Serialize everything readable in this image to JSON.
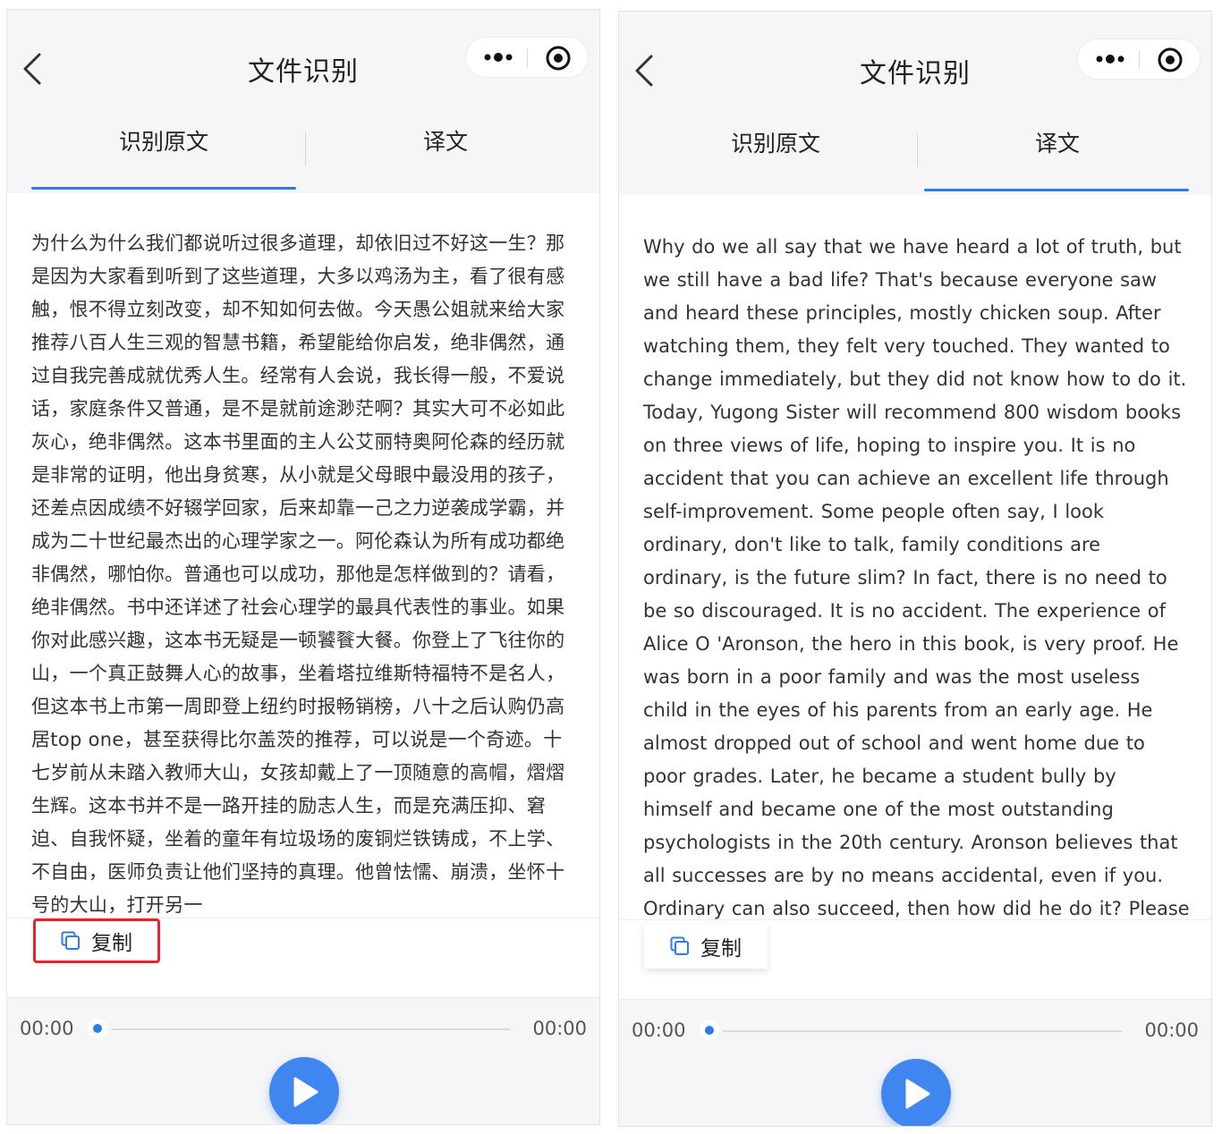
{
  "left_screen": {
    "title": "文件识别",
    "tabs": [
      "识别原文",
      "译文"
    ],
    "active_tab": "识别原文",
    "text": "为什么为什么我们都说听过很多道理，却依旧过不好这一生？那是因为大家看到听到了这些道理，大多以鸡汤为主，看了很有感触，恨不得立刻改变，却不知如何去做。今天愚公姐就来给大家推荐八百人生三观的智慧书籍，希望能给你启发，绝非偶然，通过自我完善成就优秀人生。经常有人会说，我长得一般，不爱说话，家庭条件又普通，是不是就前途渺茫啊？其实大可不必如此灰心，绝非偶然。这本书里面的主人公艾丽特奥阿伦森的经历就是非常的证明，他出身贫寒，从小就是父母眼中最没用的孩子，还差点因成绩不好辍学回家，后来却靠一己之力逆袭成学霸，并成为二十世纪最杰出的心理学家之一。阿伦森认为所有成功都绝非偶然，哪怕你。普通也可以成功，那他是怎样做到的？请看，绝非偶然。书中还详述了社会心理学的最具代表性的事业。如果你对此感兴趣，这本书无疑是一顿饕餮大餐。你登上了飞往你的山，一个真正鼓舞人心的故事，坐着塔拉维斯特福特不是名人，但这本书上市第一周即登上纽约时报畅销榜，八十之后认购仍高居top one，甚至获得比尔盖茨的推荐，可以说是一个奇迹。十七岁前从未踏入教师大山，女孩却戴上了一顶随意的高帽，熠熠生辉。这本书并不是一路开挂的励志人生，而是充满压抑、窘迫、自我怀疑，坐着的童年有垃圾场的废铜烂铁铸成，不上学、不自由，医师负责让他们坚持的真理。他曾怯懦、崩溃，坐怀十号的大山，打开另一",
    "copy_label": "复制",
    "time_start": "00:00",
    "time_end": "00:00",
    "progress": 0
  },
  "right_screen": {
    "title": "文件识别",
    "tabs": [
      "识别原文",
      "译文"
    ],
    "active_tab": "译文",
    "text": "Why do we all say that we have heard a lot of truth, but we still have a bad life? That's because everyone saw and heard these principles, mostly chicken soup. After watching them, they felt very touched. They wanted to change immediately, but they did not know how to do it. Today, Yugong Sister will recommend 800 wisdom books on three views of life, hoping to inspire you. It is no accident that you can achieve an excellent life through self-improvement. Some people often say, I look ordinary, don't like to talk, family conditions are ordinary, is the future slim? In fact, there is no need to be so discouraged. It is no accident. The experience of Alice O 'Aronson, the hero in this book, is very proof. He was born in a poor family and was the most useless child in the eyes of his parents from an early age. He almost dropped out of school and went home due to poor grades. Later, he became a student bully by himself and became one of the most outstanding psychologists in the 20th century. Aronson believes that all successes are by no means accidental, even if you. Ordinary can also succeed, then how did he do it? Please see, it is no accident. The book",
    "copy_label": "复制",
    "time_start": "00:00",
    "time_end": "00:00",
    "progress": 0
  },
  "colors": {
    "accent": "#2d7be6",
    "play_button": "#3f86f0",
    "highlight_box": "#e8222a",
    "header_bg": "#f6f6f8"
  },
  "icons": [
    "back-chevron-icon",
    "more-dots-icon",
    "target-circle-icon",
    "copy-icon",
    "play-icon"
  ]
}
